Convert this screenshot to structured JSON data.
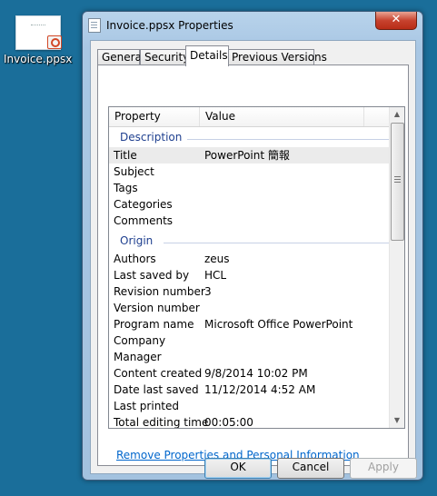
{
  "desktop": {
    "icon_label": "Invoice.ppsx"
  },
  "window": {
    "title": "Invoice.ppsx Properties",
    "close_glyph": "✕"
  },
  "tabs": [
    {
      "label": "General"
    },
    {
      "label": "Security"
    },
    {
      "label": "Details",
      "active": true
    },
    {
      "label": "Previous Versions"
    }
  ],
  "list": {
    "columns": {
      "property": "Property",
      "value": "Value"
    },
    "groups": [
      {
        "label": "Description",
        "rows": [
          {
            "key": "Title",
            "value": "PowerPoint 簡報",
            "selected": true
          },
          {
            "key": "Subject",
            "value": ""
          },
          {
            "key": "Tags",
            "value": ""
          },
          {
            "key": "Categories",
            "value": ""
          },
          {
            "key": "Comments",
            "value": ""
          }
        ]
      },
      {
        "label": "Origin",
        "rows": [
          {
            "key": "Authors",
            "value": "zeus"
          },
          {
            "key": "Last saved by",
            "value": "HCL"
          },
          {
            "key": "Revision number",
            "value": "3"
          },
          {
            "key": "Version number",
            "value": ""
          },
          {
            "key": "Program name",
            "value": "Microsoft Office PowerPoint"
          },
          {
            "key": "Company",
            "value": ""
          },
          {
            "key": "Manager",
            "value": ""
          },
          {
            "key": "Content created",
            "value": "9/8/2014 10:02 PM"
          },
          {
            "key": "Date last saved",
            "value": "11/12/2014 4:52 AM"
          },
          {
            "key": "Last printed",
            "value": ""
          },
          {
            "key": "Total editing time",
            "value": "00:05:00"
          }
        ]
      }
    ]
  },
  "link": {
    "remove_properties": "Remove Properties and Personal Information"
  },
  "buttons": {
    "ok": "OK",
    "cancel": "Cancel",
    "apply": "Apply"
  },
  "colors": {
    "desktop": "#1a6e9a",
    "group_heading": "#1e3f8f",
    "link": "#0066cc"
  }
}
